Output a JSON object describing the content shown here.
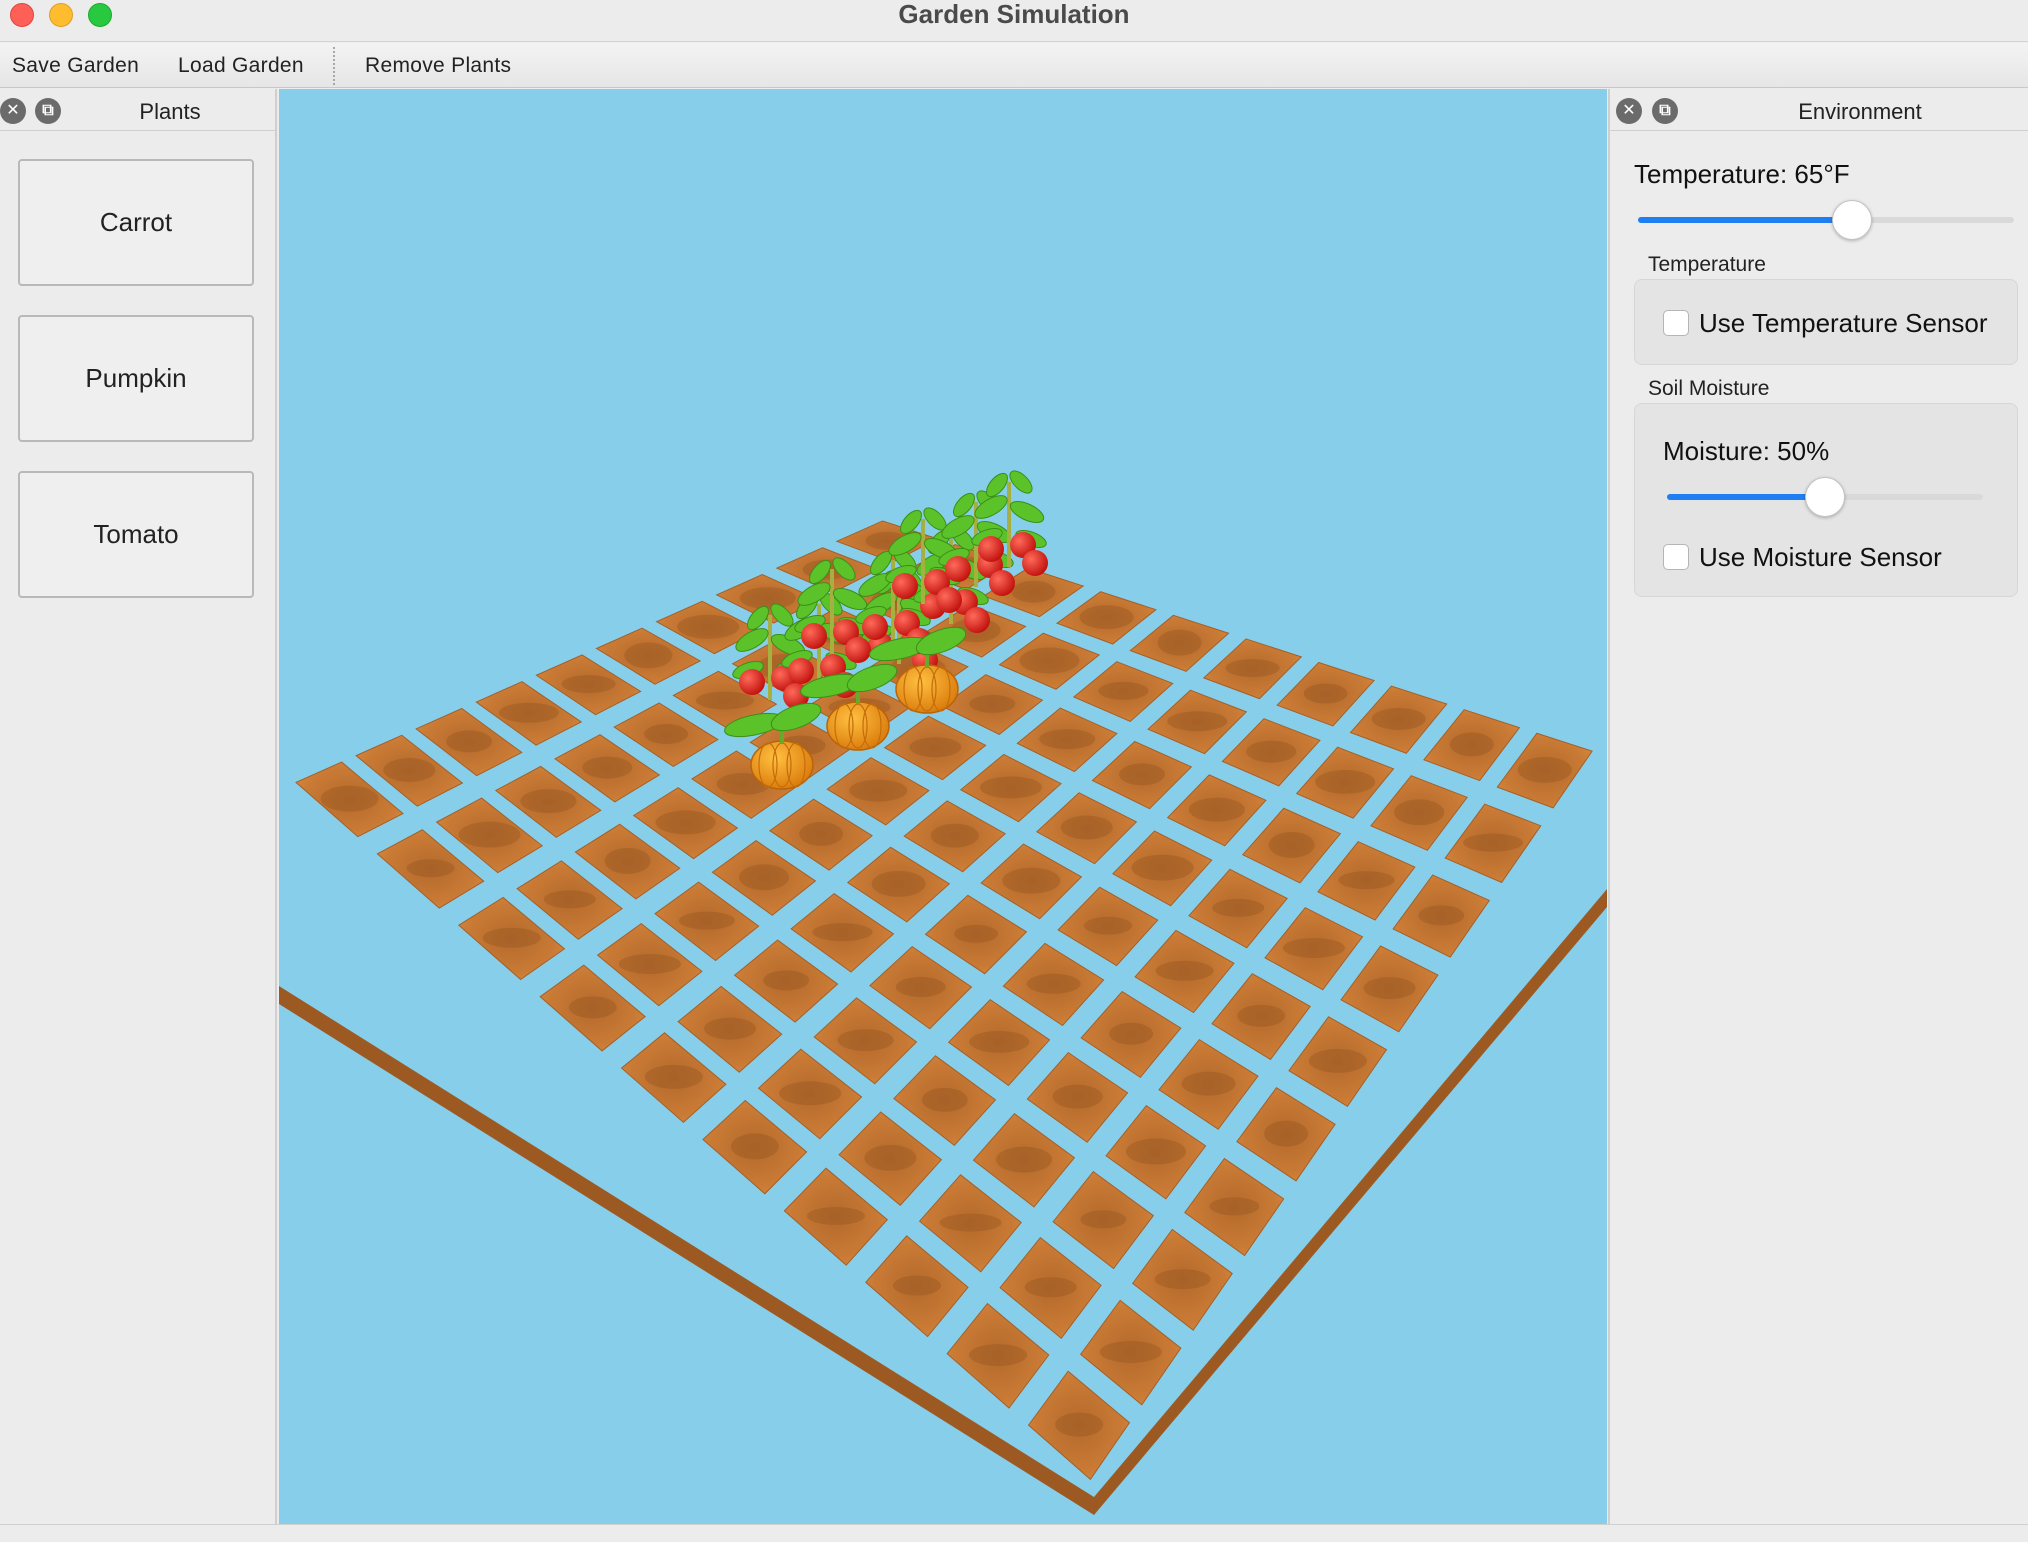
{
  "window": {
    "title": "Garden Simulation"
  },
  "toolbar": {
    "save_label": "Save Garden",
    "load_label": "Load Garden",
    "remove_label": "Remove Plants"
  },
  "plants_dock": {
    "title": "Plants",
    "items": [
      {
        "label": "Carrot"
      },
      {
        "label": "Pumpkin"
      },
      {
        "label": "Tomato"
      }
    ]
  },
  "scene": {
    "sky_color": "#87ceeb",
    "soil_color": "#c97a35",
    "grid_rows": 10,
    "grid_cols": 10,
    "tomato_plants": 9,
    "pumpkin_plants": 3
  },
  "environment_dock": {
    "title": "Environment",
    "temperature": {
      "label": "Temperature: 65°F",
      "slider_fraction": 0.57
    },
    "temperature_group": {
      "title": "Temperature",
      "sensor_label": "Use Temperature Sensor",
      "sensor_checked": false
    },
    "moisture_group": {
      "title": "Soil Moisture",
      "label": "Moisture: 50%",
      "slider_fraction": 0.5,
      "sensor_label": "Use Moisture Sensor",
      "sensor_checked": false
    }
  },
  "colors": {
    "accent": "#1f7ff2"
  }
}
